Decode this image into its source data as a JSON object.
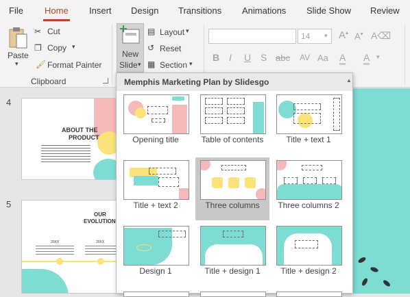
{
  "tabs": [
    "File",
    "Home",
    "Insert",
    "Design",
    "Transitions",
    "Animations",
    "Slide Show",
    "Review"
  ],
  "clipboard": {
    "paste": "Paste",
    "cut": "Cut",
    "copy": "Copy",
    "format_painter": "Format Painter",
    "group_label": "Clipboard"
  },
  "slides_group": {
    "new_slide_line1": "New",
    "new_slide_line2": "Slide",
    "layout": "Layout",
    "reset": "Reset",
    "section": "Section"
  },
  "font": {
    "size": "14",
    "bold": "B",
    "italic": "I",
    "underline": "U",
    "strike": "S",
    "shadow": "abc",
    "spacing": "AV",
    "case": "Aa",
    "color": "A",
    "highlight": "A"
  },
  "gallery": {
    "title": "Memphis Marketing Plan by Slidesgo",
    "layouts": [
      "Opening title",
      "Table of contents",
      "Title + text 1",
      "Title + text 2",
      "Three columns",
      "Three columns 2",
      "Design 1",
      "Title + design 1",
      "Title + design 2"
    ]
  },
  "thumbnails": [
    {
      "number": "4",
      "title_line1": "ABOUT THE",
      "title_line2": "PRODUCT"
    },
    {
      "number": "5",
      "title_line1": "OUR",
      "title_line2": "EVOLUTION",
      "years": [
        "20XX",
        "20XX"
      ]
    }
  ],
  "colors": {
    "accent": "#b7472a",
    "teal": "#7fdcd3",
    "pink": "#f4b9b8",
    "yellow": "#fbe27a"
  }
}
